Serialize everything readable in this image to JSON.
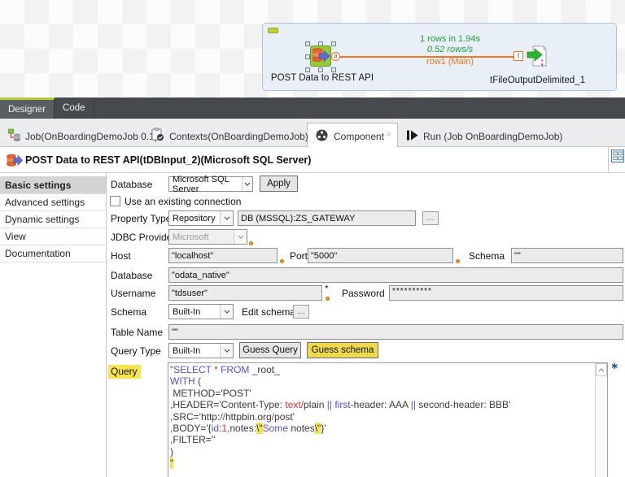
{
  "canvas": {
    "source_component": {
      "label": "POST Data to REST API"
    },
    "target_component": {
      "label": "tFileOutputDelimited_1"
    },
    "connection": {
      "stat_rows": "1 rows in 1.94s",
      "stat_rate": "0.52 rows/s",
      "row_label": "row1 (Main)",
      "output_port": "o",
      "input_port": "I"
    },
    "colors": {
      "stat_green": "#1f9e3d",
      "flow_orange": "#ee7622"
    }
  },
  "view_tabs": {
    "designer": "Designer",
    "code": "Code"
  },
  "editor_tabs": {
    "job": "Job(OnBoardingDemoJob 0.1)",
    "contexts": "Contexts(OnBoardingDemoJob)",
    "component": "Component",
    "run": "Run (Job OnBoardingDemoJob)",
    "close_glyph": "×"
  },
  "component_panel": {
    "title": "POST Data to REST API(tDBInput_2)(Microsoft SQL Server)",
    "sidebar": [
      "Basic settings",
      "Advanced settings",
      "Dynamic settings",
      "View",
      "Documentation"
    ],
    "form": {
      "database_label": "Database",
      "database_value": "Microsoft SQL Server",
      "apply_label": "Apply",
      "existing_connection_label": "Use an existing connection",
      "property_type_label": "Property Type",
      "property_type_value": "Repository",
      "repository_value": "DB (MSSQL):ZS_GATEWAY",
      "ellipsis": "…",
      "jdbc_label": "JDBC Provider",
      "jdbc_value": "Microsoft",
      "host_label": "Host",
      "host_value": "\"localhost\"",
      "port_label": "Port",
      "port_value": "\"5000\"",
      "schema_inline_label": "Schema",
      "schema_inline_value": "\"\"",
      "database2_label": "Database",
      "database2_value": "\"odata_native\"",
      "username_label": "Username",
      "username_value": "\"tdsuser\"",
      "required_marker": "*",
      "password_label": "Password",
      "password_value": "**********",
      "schema_label": "Schema",
      "schema_value": "Built-In",
      "edit_schema_label": "Edit schema",
      "table_name_label": "Table Name",
      "table_name_value": "\"\"",
      "query_type_label": "Query Type",
      "query_type_value": "Built-In",
      "guess_query_label": "Guess Query",
      "guess_schema_label": "Guess schema",
      "query_label": "Query",
      "required_blue_marker": "✱"
    },
    "query": {
      "highlight_color": "#f5e54a",
      "keyword_color": "#5a4fcf",
      "literal_color": "#cc3333",
      "lines": [
        [
          {
            "c": "red",
            "t": "\""
          },
          {
            "c": "kw",
            "t": "SELECT"
          },
          {
            "c": "p",
            "t": " "
          },
          {
            "c": "red",
            "t": "*"
          },
          {
            "c": "p",
            "t": " "
          },
          {
            "c": "kw",
            "t": "FROM"
          },
          {
            "c": "p",
            "t": " _root_"
          }
        ],
        [
          {
            "c": "kw",
            "t": "WITH"
          },
          {
            "c": "p",
            "t": " ("
          }
        ],
        [
          {
            "c": "p",
            "t": " METHOD='POST'"
          }
        ],
        [
          {
            "c": "p",
            "t": ",HEADER='Content-Type: "
          },
          {
            "c": "red",
            "t": "text"
          },
          {
            "c": "red",
            "t": "/"
          },
          {
            "c": "p",
            "t": "plain "
          },
          {
            "c": "kw",
            "t": "||"
          },
          {
            "c": "p",
            "t": " "
          },
          {
            "c": "kw",
            "t": "first"
          },
          {
            "c": "p",
            "t": "-header: AAA "
          },
          {
            "c": "kw",
            "t": "||"
          },
          {
            "c": "p",
            "t": " second-header: BBB'"
          }
        ],
        [
          {
            "c": "p",
            "t": ",SRC='http:"
          },
          {
            "c": "red",
            "t": "//"
          },
          {
            "c": "p",
            "t": "httpbin.org"
          },
          {
            "c": "red",
            "t": "/"
          },
          {
            "c": "p",
            "t": "post'"
          }
        ],
        [
          {
            "c": "p",
            "t": ",BODY='{"
          },
          {
            "c": "kw",
            "t": "id"
          },
          {
            "c": "p",
            "t": ":"
          },
          {
            "c": "red",
            "t": "1"
          },
          {
            "c": "p",
            "t": ",notes:"
          },
          {
            "c": "hl",
            "t": "\\\""
          },
          {
            "c": "kw",
            "t": "Some"
          },
          {
            "c": "p",
            "t": " notes"
          },
          {
            "c": "hl",
            "t": "\\\""
          },
          {
            "c": "p",
            "t": "}'"
          }
        ],
        [
          {
            "c": "p",
            "t": ",FILTER=''"
          }
        ],
        [
          {
            "c": "p",
            "t": ")"
          }
        ],
        [
          {
            "c": "hl",
            "t": "\""
          }
        ]
      ]
    }
  }
}
